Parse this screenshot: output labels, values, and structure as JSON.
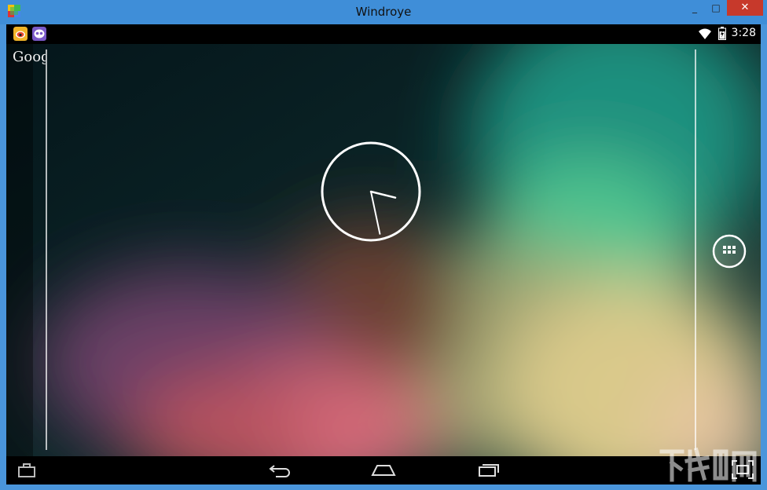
{
  "window": {
    "title": "Windroye",
    "minimize_symbol": "_",
    "maximize_symbol": "□",
    "close_symbol": "✕"
  },
  "statusbar": {
    "time": "3:28",
    "notifications": [
      "weibo-icon",
      "qq-icon"
    ],
    "icons": [
      "wifi-icon",
      "battery-icon"
    ]
  },
  "homescreen": {
    "search_widget_text": "Google",
    "clock_widget": {
      "type": "analog",
      "hour": 3,
      "minute": 28
    },
    "app_drawer_icon": "apps-grid-icon"
  },
  "navbar": {
    "buttons": [
      "briefcase-icon",
      "back-icon",
      "home-icon",
      "recents-icon",
      "screenshot-icon"
    ]
  },
  "colors": {
    "titlebar": "#3f8ed8",
    "close_button": "#c7392b",
    "bars": "#000000"
  }
}
